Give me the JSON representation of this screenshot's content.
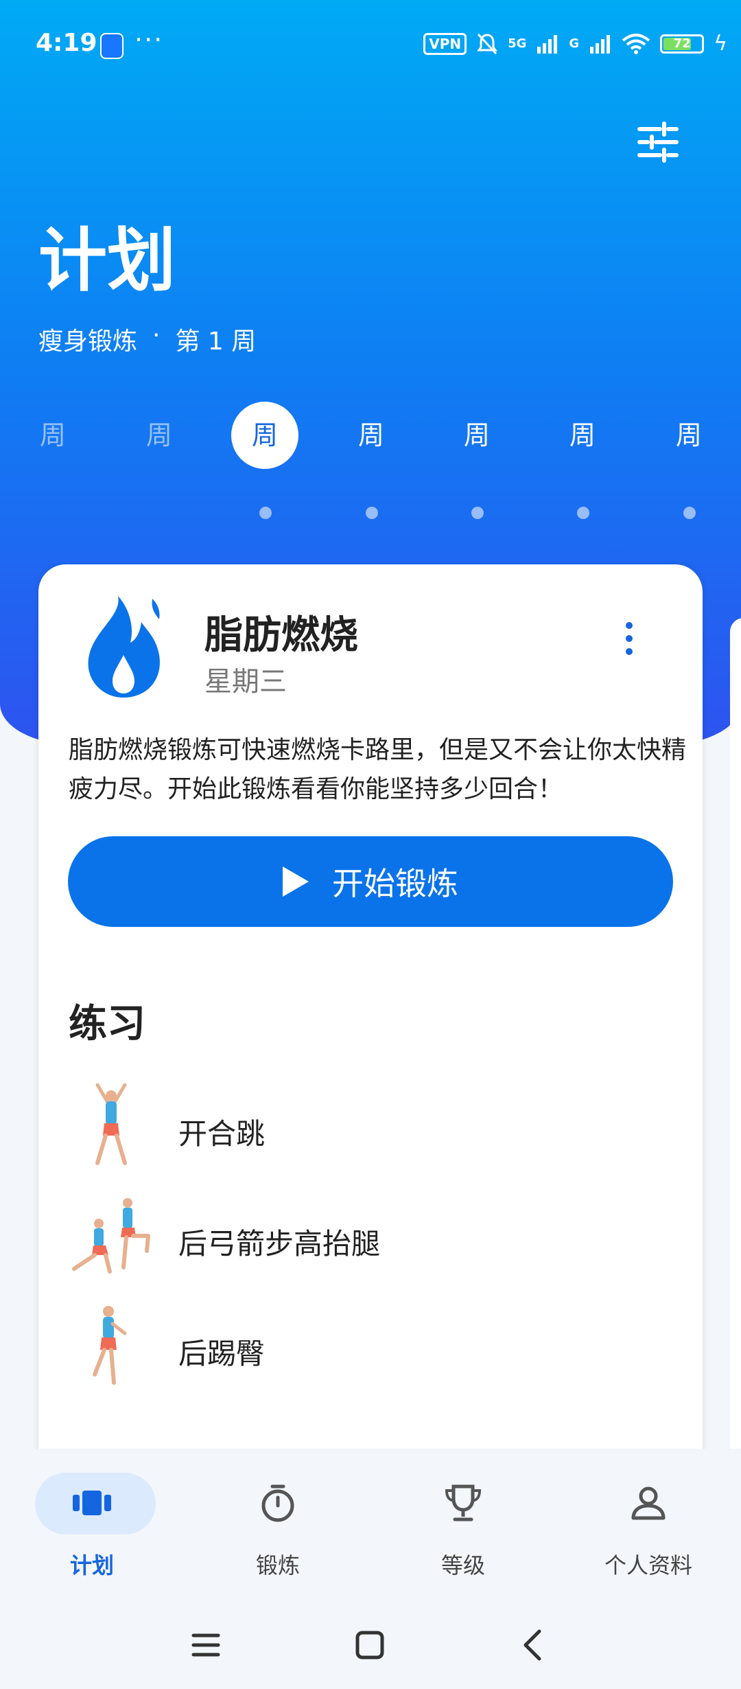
{
  "status_bar": {
    "time": "4:19",
    "more": "···",
    "vpn": "VPN",
    "signal1": "5G",
    "signal2": "G",
    "battery": "72"
  },
  "header": {
    "title": "计划",
    "plan_name": "瘦身锻炼",
    "separator": "·",
    "week_label": "第 1 周"
  },
  "week_days": [
    {
      "label": "周",
      "state": "dim"
    },
    {
      "label": "周",
      "state": "dim"
    },
    {
      "label": "周",
      "state": "active"
    },
    {
      "label": "周",
      "state": "normal"
    },
    {
      "label": "周",
      "state": "normal"
    },
    {
      "label": "周",
      "state": "normal"
    },
    {
      "label": "周",
      "state": "normal"
    }
  ],
  "workout": {
    "icon": "flame-icon",
    "title": "脂肪燃烧",
    "day": "星期三",
    "description": "脂肪燃烧锻炼可快速燃烧卡路里，但是又不会让你太快精疲力尽。开始此锻炼看看你能坚持多少回合！",
    "start_label": "开始锻炼"
  },
  "exercises": {
    "heading": "练习",
    "items": [
      {
        "name": "开合跳"
      },
      {
        "name": "后弓箭步高抬腿"
      },
      {
        "name": "后踢臀"
      }
    ]
  },
  "bottom_nav": [
    {
      "label": "计划",
      "icon": "plan-icon",
      "active": true
    },
    {
      "label": "锻炼",
      "icon": "stopwatch-icon",
      "active": false
    },
    {
      "label": "等级",
      "icon": "trophy-icon",
      "active": false
    },
    {
      "label": "个人资料",
      "icon": "profile-icon",
      "active": false
    }
  ],
  "colors": {
    "accent": "#0a73ea",
    "header_top": "#00aaf5",
    "header_bottom": "#2e53f0"
  }
}
